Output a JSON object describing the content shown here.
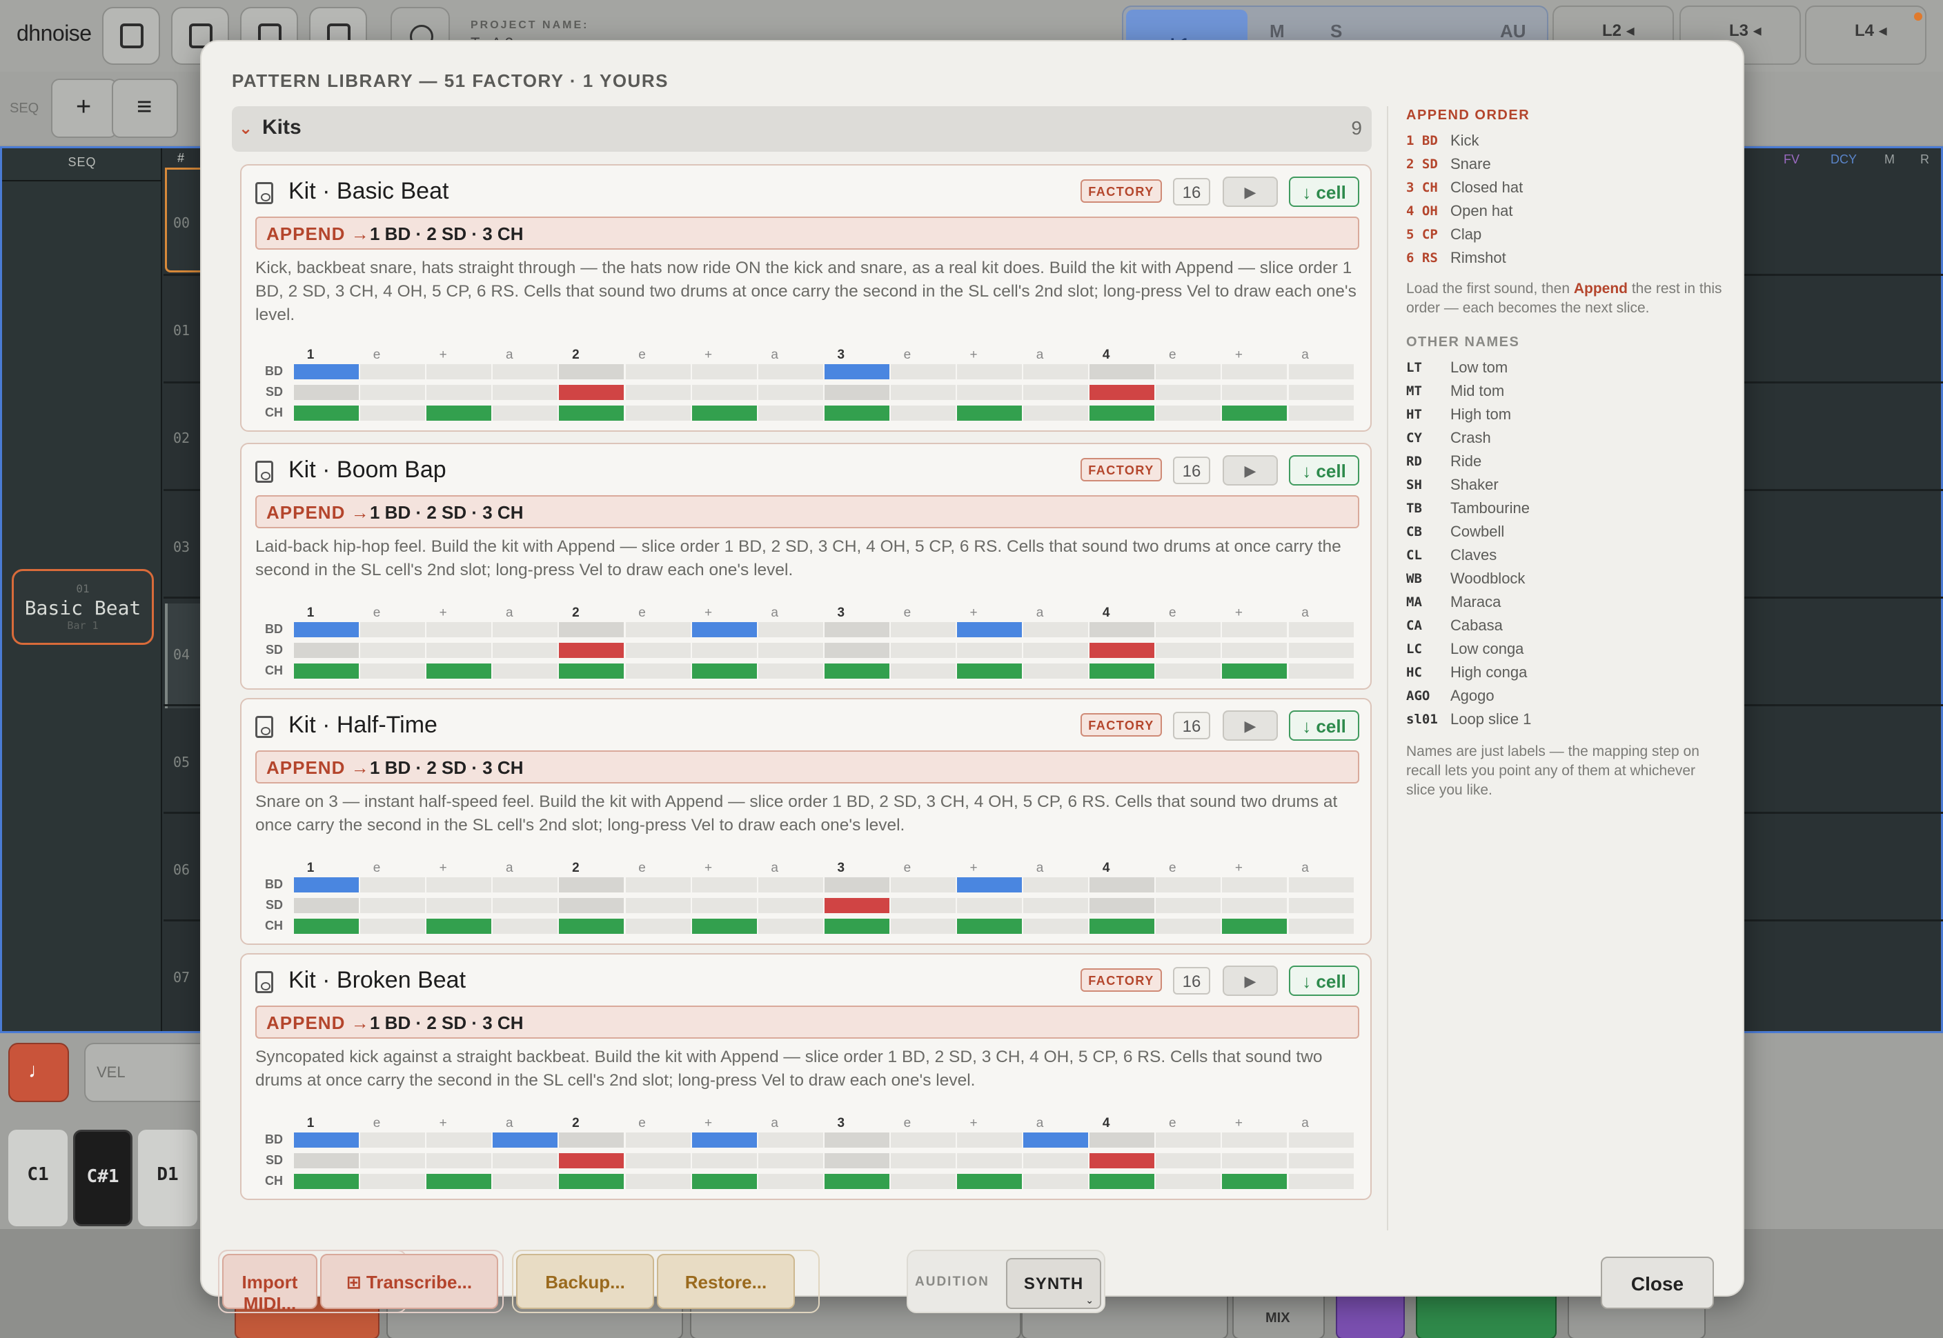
{
  "app": {
    "brand": "dhnoise",
    "project_label": "PROJECT NAME:",
    "project_value": "T . A 2",
    "lanes": [
      "L1 ▸",
      "M",
      "S",
      "AU",
      "L2 ◂",
      "L3 ◂",
      "L4 ◂"
    ],
    "seq_label": "SEQ",
    "seq_header": "SEQ",
    "row_header": "#",
    "rows": [
      "00",
      "01",
      "02",
      "03",
      "04",
      "05",
      "06",
      "07"
    ],
    "right_headers": [
      "FV",
      "DCY",
      "M",
      "R"
    ],
    "seq_card": {
      "num": "01",
      "title": "Basic Beat",
      "sub": "Bar 1"
    },
    "vel_label": "VEL",
    "keys": [
      "C1",
      "C#1",
      "D1"
    ],
    "mix_label": "MIX"
  },
  "modal": {
    "title": "PATTERN LIBRARY — 51 FACTORY · 1 YOURS",
    "section": {
      "chevron": "›",
      "title": "Kits",
      "count": "9"
    },
    "badge_factory": "FACTORY",
    "play_glyph": "▶",
    "cell_label": "↓ cell",
    "append_prefix": "APPEND →",
    "beat_labels": [
      "1",
      "e",
      "+",
      "a",
      "2",
      "e",
      "+",
      "a",
      "3",
      "e",
      "+",
      "a",
      "4",
      "e",
      "+",
      "a"
    ],
    "row_labels": [
      "BD",
      "SD",
      "CH"
    ],
    "kits": [
      {
        "name": "Kit · Basic Beat",
        "steps": "16",
        "append": "1 BD · 2 SD · 3 CH",
        "desc": "Kick, backbeat snare, hats straight through — the hats now ride ON the kick and snare, as a real kit does. Build the kit with Append — slice order 1 BD, 2 SD, 3 CH, 4 OH, 5 CP, 6 RS. Cells that sound two drums at once carry the second in the SL cell's 2nd slot; long-press Vel to draw each one's level.",
        "bd": [
          0,
          8
        ],
        "sd": [
          4,
          12
        ],
        "ch": [
          0,
          2,
          4,
          6,
          8,
          10,
          12,
          14
        ]
      },
      {
        "name": "Kit · Boom Bap",
        "steps": "16",
        "append": "1 BD · 2 SD · 3 CH",
        "desc": "Laid-back hip-hop feel. Build the kit with Append — slice order 1 BD, 2 SD, 3 CH, 4 OH, 5 CP, 6 RS. Cells that sound two drums at once carry the second in the SL cell's 2nd slot; long-press Vel to draw each one's level.",
        "bd": [
          0,
          6,
          10
        ],
        "sd": [
          4,
          12
        ],
        "ch": [
          0,
          2,
          4,
          6,
          8,
          10,
          12,
          14
        ]
      },
      {
        "name": "Kit · Half-Time",
        "steps": "16",
        "append": "1 BD · 2 SD · 3 CH",
        "desc": "Snare on 3 — instant half-speed feel. Build the kit with Append — slice order 1 BD, 2 SD, 3 CH, 4 OH, 5 CP, 6 RS. Cells that sound two drums at once carry the second in the SL cell's 2nd slot; long-press Vel to draw each one's level.",
        "bd": [
          0,
          10
        ],
        "sd": [
          8
        ],
        "ch": [
          0,
          2,
          4,
          6,
          8,
          10,
          12,
          14
        ]
      },
      {
        "name": "Kit · Broken Beat",
        "steps": "16",
        "append": "1 BD · 2 SD · 3 CH",
        "desc": "Syncopated kick against a straight backbeat. Build the kit with Append — slice order 1 BD, 2 SD, 3 CH, 4 OH, 5 CP, 6 RS. Cells that sound two drums at once carry the second in the SL cell's 2nd slot; long-press Vel to draw each one's level.",
        "bd": [
          0,
          3,
          6,
          11
        ],
        "sd": [
          4,
          12
        ],
        "ch": [
          0,
          2,
          4,
          6,
          8,
          10,
          12,
          14
        ]
      }
    ],
    "side": {
      "append_heading": "APPEND ORDER",
      "append_order": [
        {
          "k": "1 BD",
          "v": "Kick"
        },
        {
          "k": "2 SD",
          "v": "Snare"
        },
        {
          "k": "3 CH",
          "v": "Closed hat"
        },
        {
          "k": "4 OH",
          "v": "Open hat"
        },
        {
          "k": "5 CP",
          "v": "Clap"
        },
        {
          "k": "6 RS",
          "v": "Rimshot"
        }
      ],
      "append_note_1": "Load the first sound, then ",
      "append_note_em": "Append",
      "append_note_2": " the rest in this order — each becomes the next slice.",
      "other_heading": "OTHER NAMES",
      "other_names": [
        {
          "k": "LT",
          "v": "Low tom"
        },
        {
          "k": "MT",
          "v": "Mid tom"
        },
        {
          "k": "HT",
          "v": "High tom"
        },
        {
          "k": "CY",
          "v": "Crash"
        },
        {
          "k": "RD",
          "v": "Ride"
        },
        {
          "k": "SH",
          "v": "Shaker"
        },
        {
          "k": "TB",
          "v": "Tambourine"
        },
        {
          "k": "CB",
          "v": "Cowbell"
        },
        {
          "k": "CL",
          "v": "Claves"
        },
        {
          "k": "WB",
          "v": "Woodblock"
        },
        {
          "k": "MA",
          "v": "Maraca"
        },
        {
          "k": "CA",
          "v": "Cabasa"
        },
        {
          "k": "LC",
          "v": "Low conga"
        },
        {
          "k": "HC",
          "v": "High conga"
        },
        {
          "k": "AGO",
          "v": "Agogo"
        },
        {
          "k": "sl01",
          "v": "Loop slice 1"
        }
      ],
      "names_note": "Names are just labels — the mapping step on recall lets you point any of them at whichever slice you like."
    },
    "footer": {
      "import": "Import MIDI...",
      "transcribe": "⊞ Transcribe...",
      "backup": "Backup...",
      "restore": "Restore...",
      "audition_label": "AUDITION",
      "synth": "SYNTH",
      "close": "Close"
    },
    "colors": {
      "accent": "#b4452c",
      "bd": "#4a86e0",
      "sd": "#d04444",
      "ch": "#33a04e"
    }
  }
}
